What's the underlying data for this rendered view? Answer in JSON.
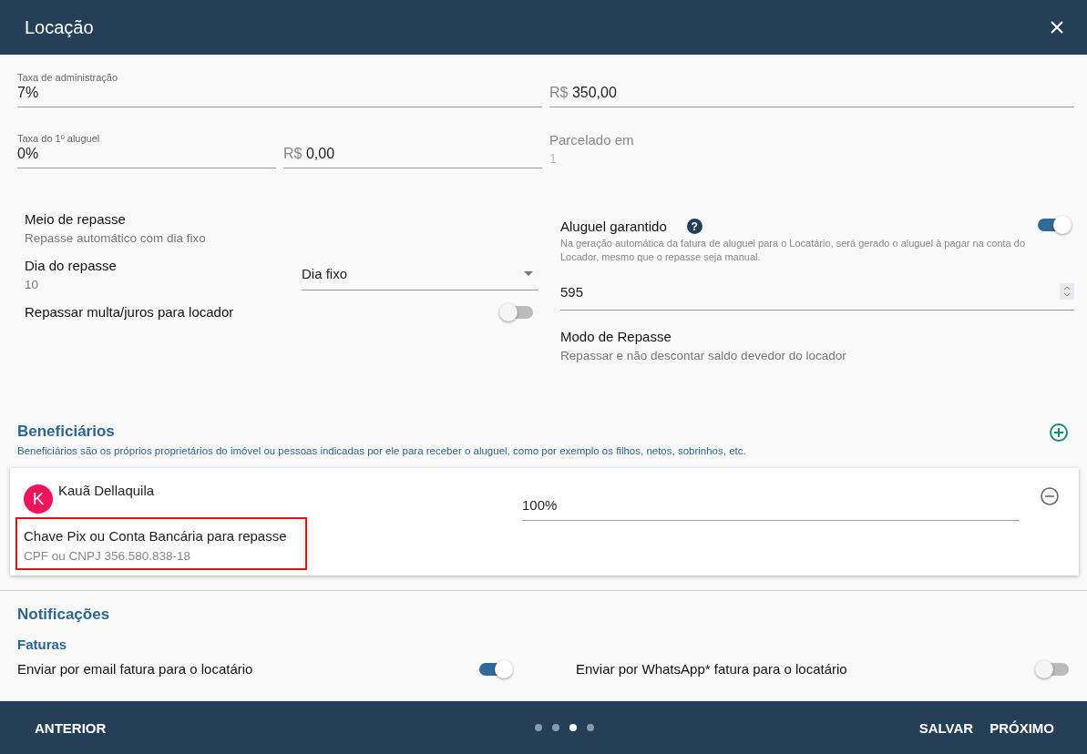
{
  "dialog": {
    "title": "Locação"
  },
  "fee_rows": [
    {
      "fields": [
        {
          "kind": "labeled",
          "label": "Taxa de administração",
          "value": "7%"
        },
        {
          "kind": "money",
          "prefix": "R$",
          "value": "350,00"
        }
      ]
    },
    {
      "fields": [
        {
          "kind": "labeled",
          "label": "Taxa do 1º aluguel",
          "value": "0%"
        },
        {
          "kind": "money",
          "prefix": "R$",
          "value": "0,00"
        },
        {
          "kind": "readonly",
          "label": "Parcelado em",
          "value": "1",
          "disabled": true
        }
      ]
    }
  ],
  "repasse": {
    "meio": {
      "label": "Meio de repasse",
      "value": "Repasse automático com dia fixo"
    },
    "dia": {
      "label": "Dia do repasse",
      "value": "10"
    },
    "select": {
      "value": "Dia fixo"
    },
    "multa": {
      "label": "Repassar multa/juros para locador",
      "on": false
    },
    "garantido": {
      "label": "Aluguel garantido",
      "help": "?",
      "description": "Na geração automática da fatura de aluguel para o Locatário, será gerado o aluguel à pagar na conta do Locador, mesmo que o repasse seja manual.",
      "on": true
    },
    "number": {
      "value": "595"
    },
    "modo": {
      "label": "Modo de Repasse",
      "value": "Repassar e não descontar saldo devedor do locador"
    }
  },
  "beneficiarios": {
    "title": "Beneficiários",
    "description": "Beneficiários são os próprios proprietários do imóvel ou pessoas indicadas por ele para receber o aluguel, como por exemplo os filhos, netos, sobrinhos, etc.",
    "items": [
      {
        "initial": "K",
        "name": "Kauã Dellaquila",
        "percent": "100%",
        "pix_label": "Chave Pix ou Conta Bancária para repasse",
        "pix_value": "CPF ou CNPJ 356.580.838-18",
        "highlighted": true
      }
    ]
  },
  "notificacoes": {
    "title": "Notificações",
    "subtitle": "Faturas",
    "toggles": [
      {
        "label": "Enviar por email fatura para o locatário",
        "on": true
      },
      {
        "label": "Enviar por WhatsApp* fatura para o locatário",
        "on": false
      }
    ]
  },
  "footer": {
    "back": "ANTERIOR",
    "steps": [
      {
        "selected": false
      },
      {
        "selected": false
      },
      {
        "selected": true
      },
      {
        "selected": false
      }
    ],
    "save": "SALVAR",
    "next": "PRÓXIMO"
  }
}
